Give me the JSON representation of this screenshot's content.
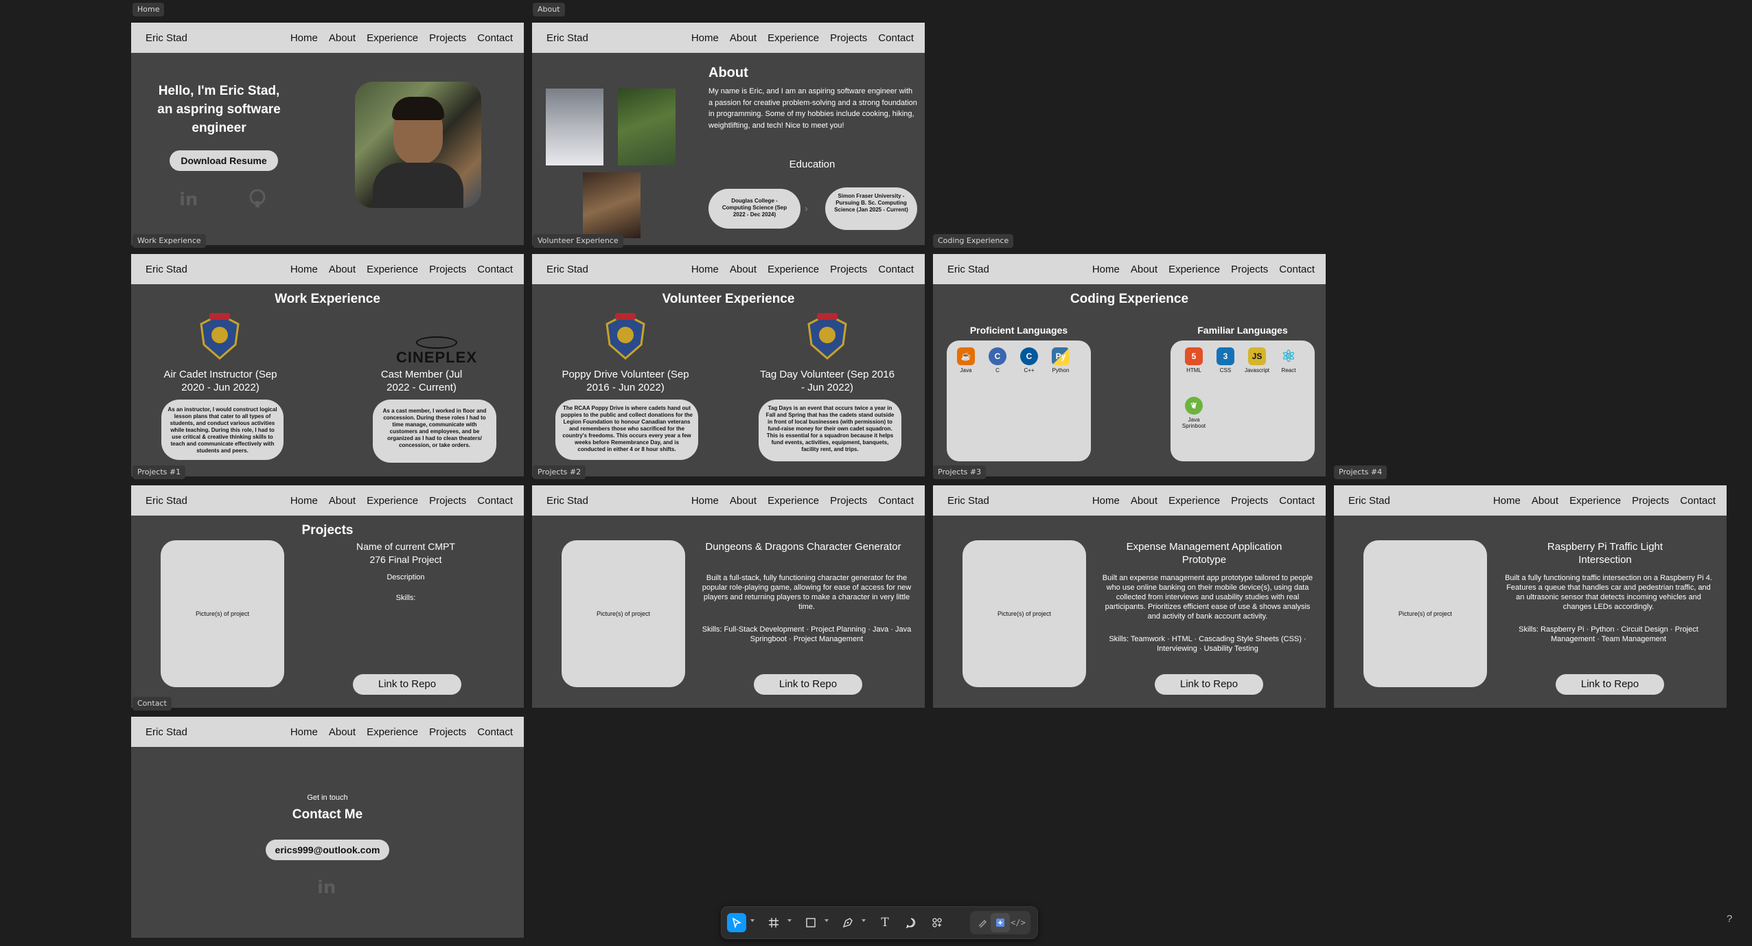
{
  "nav": {
    "brand": "Eric Stad",
    "links": [
      "Home",
      "About",
      "Experience",
      "Projects",
      "Contact"
    ]
  },
  "frames": {
    "home": {
      "tag": "Home",
      "greeting": "Hello, I'm Eric Stad, an aspring software engineer",
      "button": "Download Resume"
    },
    "about": {
      "tag": "About",
      "title": "About",
      "text": "My name is Eric, and I am an aspiring software engineer with a passion for creative problem-solving and a strong foundation in programming. Some of my hobbies include cooking, hiking, weightlifting, and tech! Nice to meet you!",
      "education_title": "Education",
      "edu1": "Douglas College - Computing Science (Sep 2022 - Dec 2024)",
      "edu2": "Simon Fraser University - Pursuing B. Sc. Computing Science (Jan 2025 - Current)"
    },
    "work": {
      "tag": "Work Experience",
      "title": "Work Experience",
      "job1_title": "Air Cadet Instructor (Sep 2020 - Jun 2022)",
      "job1_desc": "As an instructor, I would construct logical lesson plans that cater to all types of students, and conduct various activities while teaching. During this role, I had to use critical & creative thinking skills to teach and communicate effectively with students and peers.",
      "job2_logo": "CINEPLEX",
      "job2_title": "Cast Member (Jul 2022 - Current)",
      "job2_desc": "As a cast member, I worked in floor and concession. During these roles I had to time manage, communicate with customers and employees, and be organized as I had to clean theaters/ concession, or take orders."
    },
    "volunteer": {
      "tag": "Volunteer Experience",
      "title": "Volunteer Experience",
      "v1_title": "Poppy Drive Volunteer (Sep 2016 - Jun 2022)",
      "v1_desc": "The RCAA Poppy Drive is where cadets hand out poppies to the public and collect donations for the Legion Foundation to honour Canadian veterans and remembers those who sacrificed for the country's freedoms. This occurs every year a few weeks before Remembrance Day, and is conducted in either 4 or 8 hour shifts.",
      "v2_title": "Tag Day Volunteer (Sep 2016 - Jun 2022)",
      "v2_desc": "Tag Days is an event that occurs twice a year in Fall and Spring that has the cadets stand outside in front of local businesses (with permission) to fund-raise money for their own cadet squadron. This is essential for a squadron because it helps fund events, activities, equipment, banquets, facility rent, and trips."
    },
    "coding": {
      "tag": "Coding Experience",
      "title": "Coding Experience",
      "proficient_title": "Proficient Languages",
      "familiar_title": "Familiar Languages",
      "proficient": [
        {
          "name": "Java",
          "color": "#e76f00",
          "icon": "java-icon"
        },
        {
          "name": "C",
          "color": "#3a67b0",
          "icon": "c-icon"
        },
        {
          "name": "C++",
          "color": "#00599c",
          "icon": "cpp-icon"
        },
        {
          "name": "Python",
          "color": "#3572a5",
          "icon": "python-icon"
        }
      ],
      "familiar": [
        {
          "name": "HTML",
          "color": "#e34f26",
          "icon": "html-icon"
        },
        {
          "name": "CSS",
          "color": "#1572b6",
          "icon": "css-icon"
        },
        {
          "name": "Javascript",
          "color": "#d6b52a",
          "icon": "javascript-icon"
        },
        {
          "name": "React",
          "color": "#3ab8d8",
          "icon": "react-icon"
        },
        {
          "name": "Java Sprinboot",
          "color": "#6db33f",
          "icon": "spring-icon"
        }
      ]
    },
    "p1": {
      "tag": "Projects #1",
      "title": "Projects",
      "name": "Name of current CMPT 276 Final Project",
      "desc": "Description",
      "skills": "Skills:",
      "pic": "Picture(s) of project",
      "button": "Link to Repo"
    },
    "p2": {
      "tag": "Projects #2",
      "name": "Dungeons & Dragons Character Generator",
      "desc": "Built a full-stack, fully functioning character generator for the popular role-playing game, allowing for ease of access for new players and returning players to make a character in very little time.",
      "skills": "Skills: Full-Stack Development · Project Planning · Java · Java Springboot · Project Management",
      "pic": "Picture(s) of project",
      "button": "Link to Repo"
    },
    "p3": {
      "tag": "Projects #3",
      "name": "Expense Management Application Prototype",
      "desc": "Built an expense management app prototype tailored to people who use online banking on their mobile device(s), using data collected from interviews and usability studies with real participants. Prioritizes efficient ease of use & shows analysis and activity of bank account activity.",
      "skills": "Skills: Teamwork · HTML · Cascading Style Sheets (CSS) · Interviewing · Usability Testing",
      "pic": "Picture(s) of project",
      "button": "Link to Repo"
    },
    "p4": {
      "tag": "Projects #4",
      "name": "Raspberry Pi Traffic Light Intersection",
      "desc": "Built a fully functioning traffic intersection on a Raspberry Pi 4. Features a queue that handles car and pedestrian traffic, and an ultrasonic sensor that detects incoming vehicles and changes LEDs accordingly.",
      "skills": "Skills: Raspberry Pi · Python · Circuit Design · Project Management · Team Management",
      "pic": "Picture(s) of project",
      "button": "Link to Repo"
    },
    "contact": {
      "tag": "Contact",
      "kicker": "Get in touch",
      "title": "Contact Me",
      "email": "erics999@outlook.com"
    }
  },
  "help": "?"
}
